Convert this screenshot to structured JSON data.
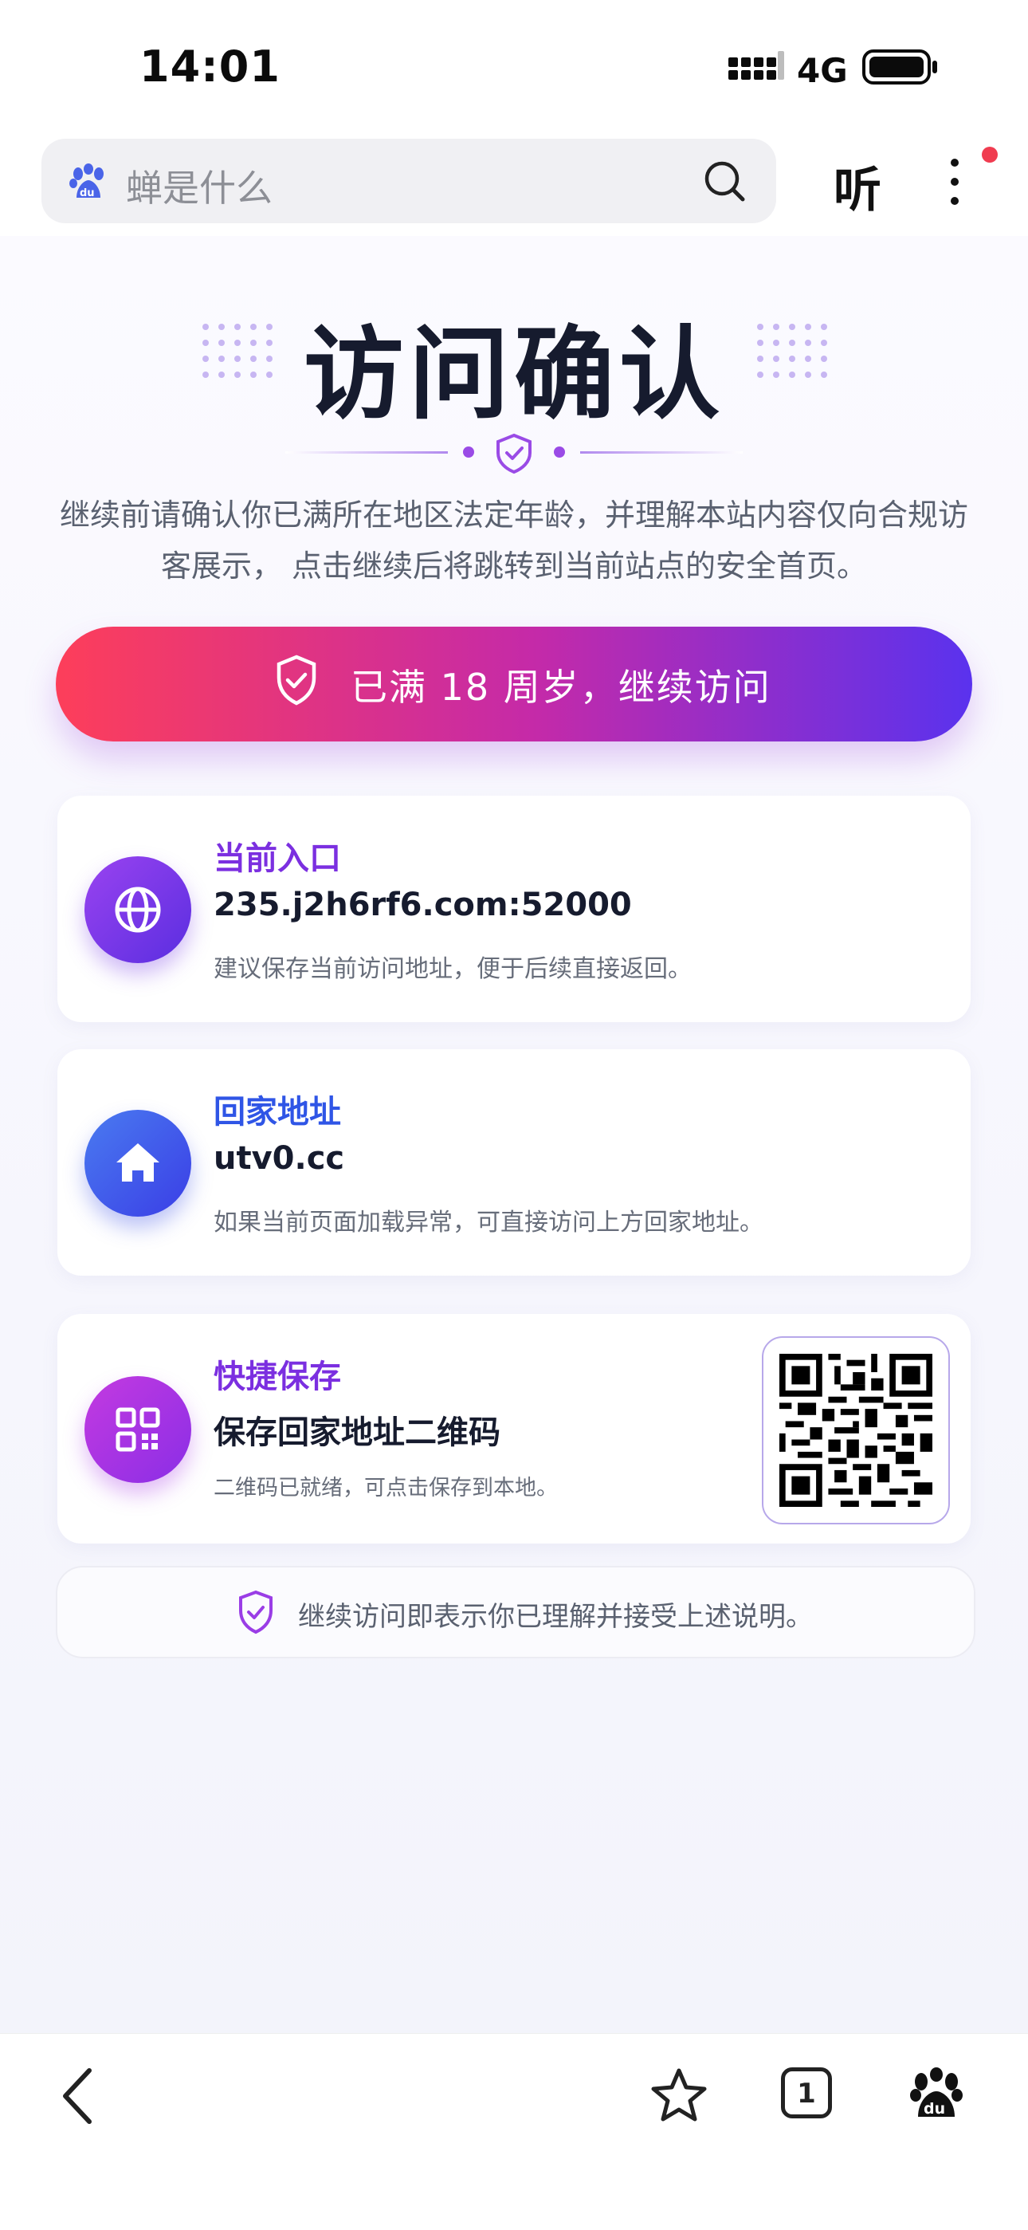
{
  "status_bar": {
    "time": "14:01",
    "network": "4G"
  },
  "search": {
    "placeholder": "蝉是什么"
  },
  "header": {
    "listen_label": "听"
  },
  "page": {
    "title": "访问确认",
    "description": "继续前请确认你已满所在地区法定年龄，并理解本站内容仅向合规访客展示， 点击继续后将跳转到当前站点的安全首页。",
    "cta_label": "已满 18 周岁，继续访问"
  },
  "cards": [
    {
      "title": "当前入口",
      "value": "235.j2h6rf6.com:52000",
      "note": "建议保存当前访问地址，便于后续直接返回。",
      "icon": "globe-icon"
    },
    {
      "title": "回家地址",
      "value": "utv0.cc",
      "note": "如果当前页面加载异常，可直接访问上方回家地址。",
      "icon": "home-icon"
    },
    {
      "title": "快捷保存",
      "value": "保存回家地址二维码",
      "note": "二维码已就绪，可点击保存到本地。",
      "icon": "qr-grid-icon"
    }
  ],
  "footer_note": "继续访问即表示你已理解并接受上述说明。",
  "bottom_bar": {
    "tab_count": "1"
  },
  "colors": {
    "accent_purple": "#7b2fe0",
    "accent_blue": "#2f55e6",
    "cta_start": "#fd3e5a",
    "cta_end": "#5a32ee"
  }
}
